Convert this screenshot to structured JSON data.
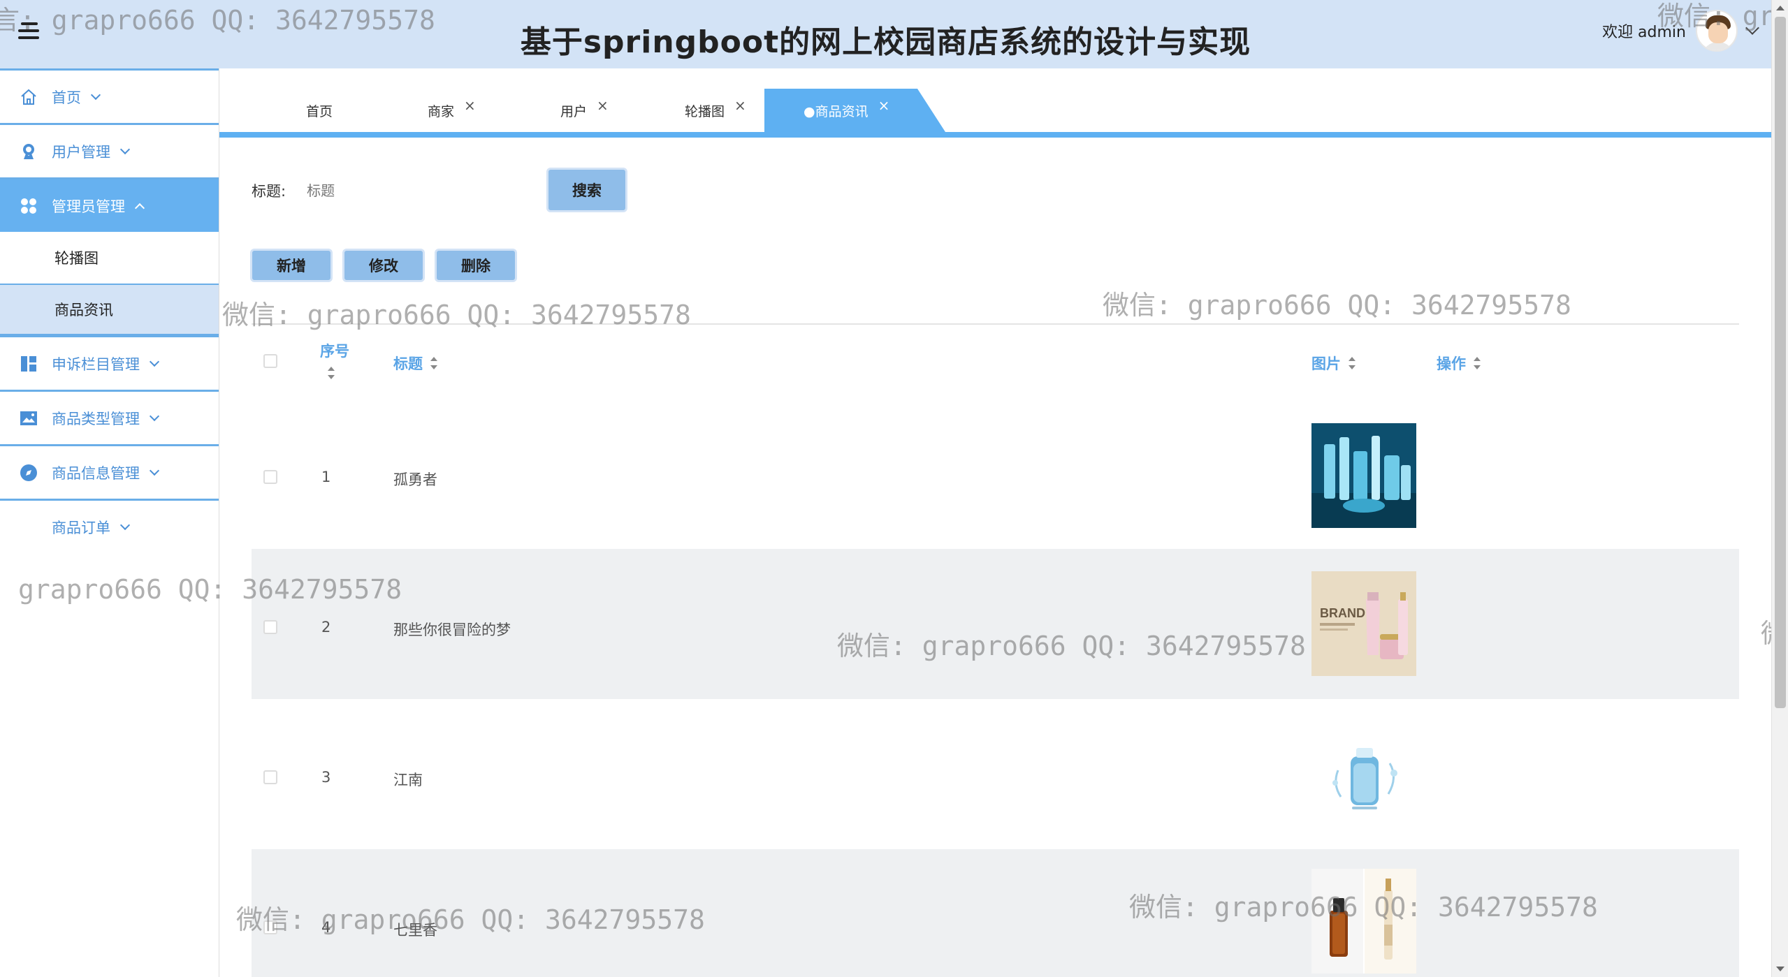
{
  "header": {
    "title": "基于springboot的网上校园商店系统的设计与实现",
    "welcome": "欢迎 admin"
  },
  "sidebar": {
    "items": [
      {
        "label": "首页",
        "icon": "home-icon"
      },
      {
        "label": "用户管理",
        "icon": "user-icon"
      },
      {
        "label": "管理员管理",
        "icon": "grid-icon",
        "expanded": true
      },
      {
        "label": "申诉栏目管理",
        "icon": "dashboard-icon"
      },
      {
        "label": "商品类型管理",
        "icon": "image-icon"
      },
      {
        "label": "商品信息管理",
        "icon": "compass-icon"
      },
      {
        "label": "商品订单",
        "icon": ""
      }
    ],
    "sub_items": [
      "轮播图",
      "商品资讯"
    ]
  },
  "tabs": [
    {
      "label": "首页"
    },
    {
      "label": "商家",
      "closable": true
    },
    {
      "label": "用户",
      "closable": true
    },
    {
      "label": "轮播图",
      "closable": true
    },
    {
      "label": "●商品资讯",
      "closable": true,
      "active": true
    }
  ],
  "tab_close": "×",
  "search": {
    "label": "标题:",
    "placeholder": "标题",
    "button": "搜索"
  },
  "actions": {
    "add": "新增",
    "edit": "修改",
    "delete": "删除"
  },
  "table": {
    "columns": [
      "序号",
      "标题",
      "图片",
      "操作"
    ],
    "rows": [
      {
        "index": "1",
        "title": "孤勇者",
        "image": "blue-cosmetic-bottles"
      },
      {
        "index": "2",
        "title": "那些你很冒险的梦",
        "image": "brand-cosmetic-set",
        "image_text": "BRAND"
      },
      {
        "index": "3",
        "title": "江南",
        "image": "blue-serum-bottle"
      },
      {
        "index": "4",
        "title": "七里香",
        "image": "amber-and-gold-bottles"
      }
    ]
  },
  "watermarks": [
    "言: grapro666 QQ: 3642795578",
    "微信: gra",
    "微信: grapro666 QQ: 3642795578",
    "微信: grapro666 QQ: 3642795578",
    "grapro666 QQ: 3642795578",
    "微信: grapro666 QQ: 3642795578",
    "微",
    "微信: grapro666 QQ: 3642795578",
    "微信: grapro666 QQ: 3642795578"
  ],
  "colors": {
    "header_bg": "#d3e3f6",
    "accent": "#5eb0f2",
    "button": "#8fbde9",
    "link": "#4a8fd6"
  }
}
